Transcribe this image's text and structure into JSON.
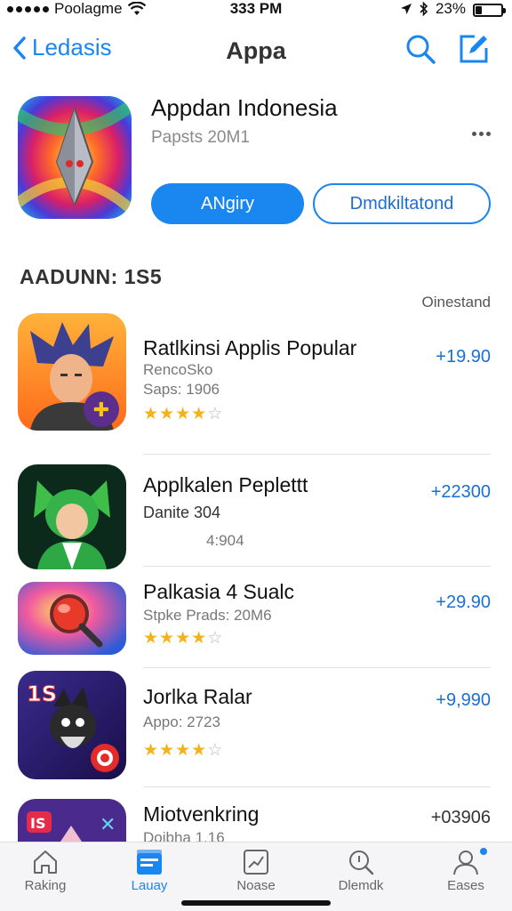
{
  "status_bar": {
    "carrier": "Poolagme",
    "time": "333 PM",
    "battery": "23%",
    "battery_level": 0.23
  },
  "nav": {
    "back_label": "Ledasis",
    "title": "Appa",
    "icons": [
      "search-icon",
      "compose-icon"
    ]
  },
  "featured": {
    "title": "Appdan Indonesia",
    "subtitle": "Papsts 20M1",
    "primary_button": "ANgiry",
    "secondary_button": "Dmdkiltatond"
  },
  "section": {
    "title": "AADUNN: 1S5",
    "link": "Oinestand"
  },
  "apps": [
    {
      "name": "Ratlkinsi Applis Popular",
      "meta1": "RencoSko",
      "meta2": "Saps: 1906",
      "price": "+19.90",
      "rating": 4
    },
    {
      "name": "Applkalen Peplettt",
      "meta1": "Danite 304",
      "meta2": "4:904",
      "price": "+22300",
      "rating": null
    },
    {
      "name": "Palkasia 4 Sualc",
      "meta1": "Stpke Prads: 20M6",
      "meta2": "",
      "price": "+29.90",
      "rating": 4
    },
    {
      "name": "Jorlka Ralar",
      "meta1": "Appo: 2723",
      "meta2": "",
      "price": "+9,990",
      "rating": 4
    },
    {
      "name": "Miotvenkring",
      "meta1": "Doibha 1.16",
      "meta2": "",
      "price": "+03906",
      "rating": null
    }
  ],
  "tabs": [
    {
      "label": "Raking",
      "icon": "home-icon",
      "active": false
    },
    {
      "label": "Lauay",
      "icon": "apps-icon",
      "active": true
    },
    {
      "label": "Noase",
      "icon": "chart-icon",
      "active": false
    },
    {
      "label": "Dlemdk",
      "icon": "search-icon",
      "active": false
    },
    {
      "label": "Eases",
      "icon": "profile-icon",
      "active": false
    }
  ],
  "colors": {
    "accent": "#1a86f0",
    "star": "#f6b21b"
  }
}
